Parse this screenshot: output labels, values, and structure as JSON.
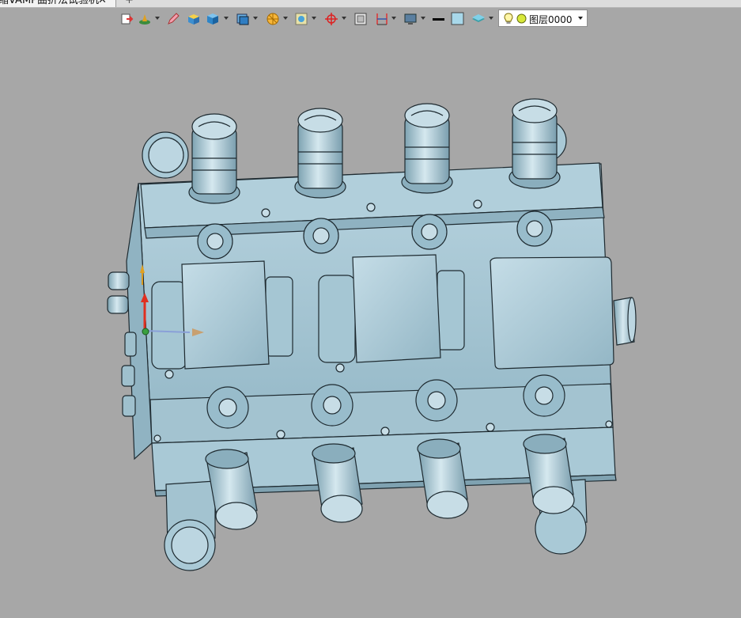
{
  "document_tab": {
    "title": "缩VAMP曲折法试验机",
    "close_glyph": "✕",
    "add_glyph": "+"
  },
  "toolbar": {
    "items": [
      {
        "icon": "exit-sketch-icon"
      },
      {
        "icon": "solid-feature-icon",
        "dropdown": true
      },
      {
        "icon": "edit-pencil-icon"
      },
      {
        "icon": "box-solid-icon"
      },
      {
        "icon": "render-cube-icon",
        "dropdown": true
      },
      {
        "icon": "view-orientation-icon",
        "dropdown": true
      },
      {
        "icon": "section-view-icon",
        "dropdown": true
      },
      {
        "icon": "display-mode-icon",
        "dropdown": true
      },
      {
        "icon": "crosshair-origin-icon",
        "dropdown": true
      },
      {
        "icon": "grid-frame-icon"
      },
      {
        "icon": "dimension-icon",
        "dropdown": true
      },
      {
        "icon": "monitor-display-icon",
        "dropdown": true
      },
      {
        "icon": "line-color-icon"
      },
      {
        "icon": "fill-color-icon"
      },
      {
        "icon": "layer-stack-icon",
        "dropdown": true
      }
    ],
    "line_color": "#000000",
    "fill_color": "#a8d8ea"
  },
  "layer_selector": {
    "value": "图层0000"
  },
  "colors": {
    "background": "#a7a7a7",
    "model": "#a9c9d6",
    "model_dark": "#7ea3b2",
    "outline": "#1e2a30"
  }
}
